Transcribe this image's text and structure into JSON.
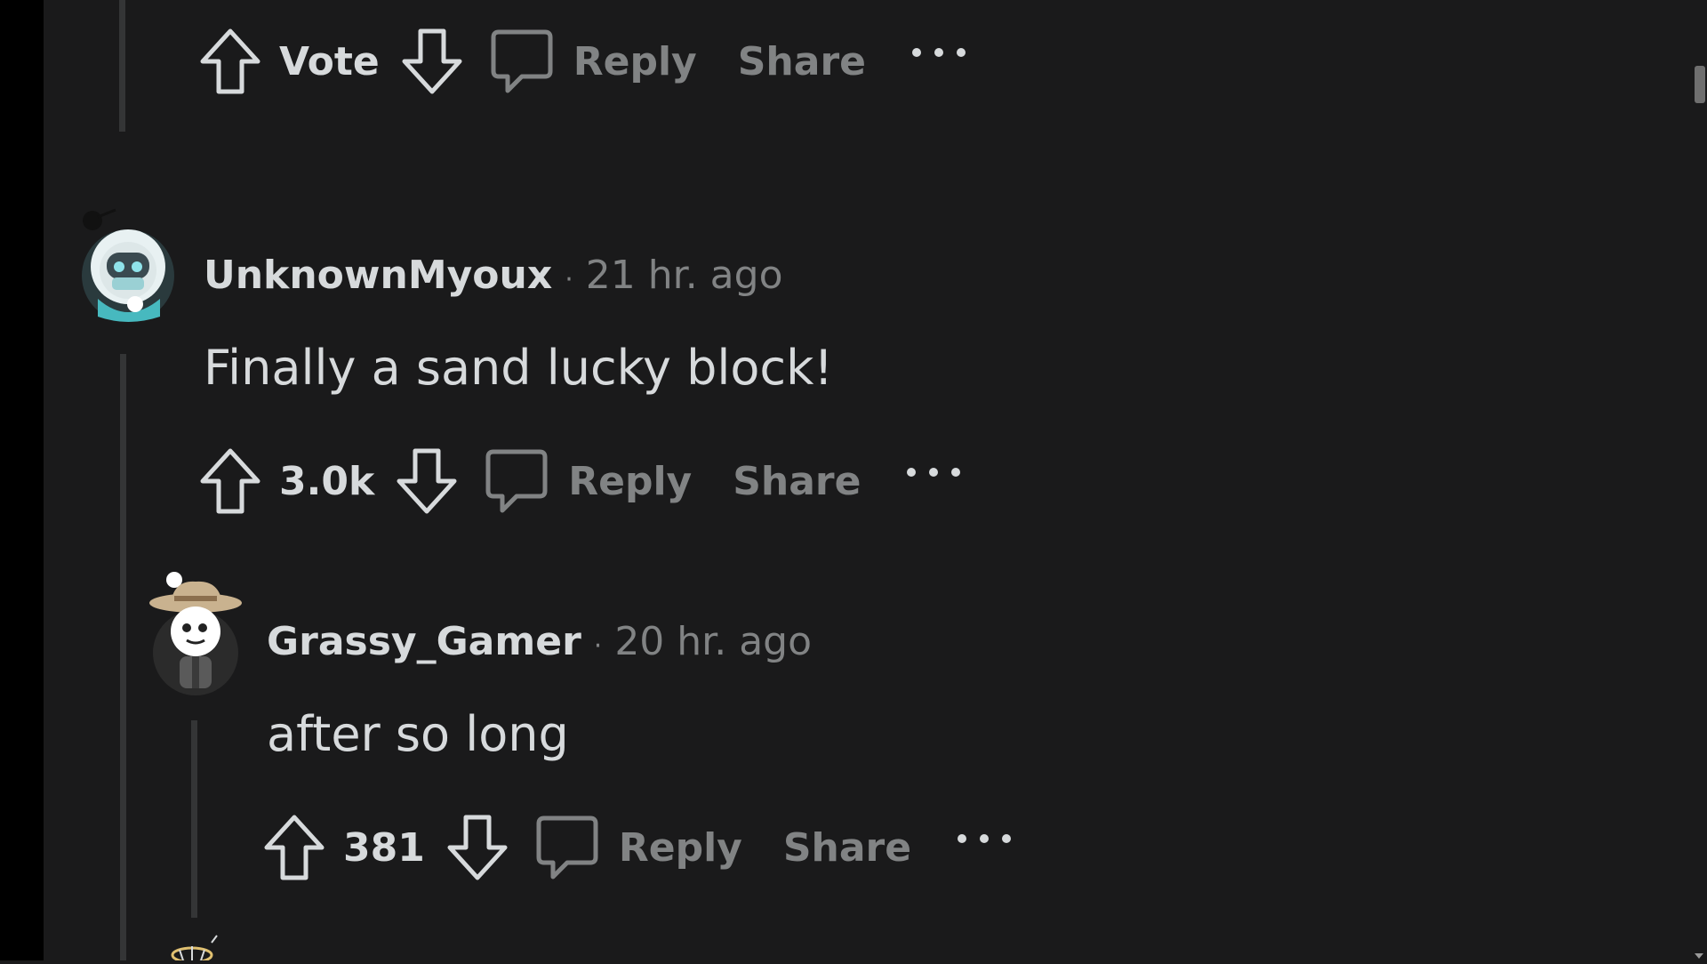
{
  "top_comment": {
    "vote_label": "Vote",
    "reply_label": "Reply",
    "share_label": "Share"
  },
  "comments": [
    {
      "author": "UnknownMyoux",
      "separator": "·",
      "time": "21 hr. ago",
      "body": "Finally a sand lucky block!",
      "votes": "3.0k",
      "reply_label": "Reply",
      "share_label": "Share"
    },
    {
      "author": "Grassy_Gamer",
      "separator": "·",
      "time": "20 hr. ago",
      "body": "after so long",
      "votes": "381",
      "reply_label": "Reply",
      "share_label": "Share"
    }
  ],
  "icons": {
    "upvote": "arrow-up-outline",
    "downvote": "arrow-down-outline",
    "reply": "speech-bubble-outline",
    "more": "three-dots"
  },
  "colors": {
    "background": "#1a1a1b",
    "text": "#d7dadc",
    "muted": "#818384",
    "thread_line": "#343536"
  }
}
